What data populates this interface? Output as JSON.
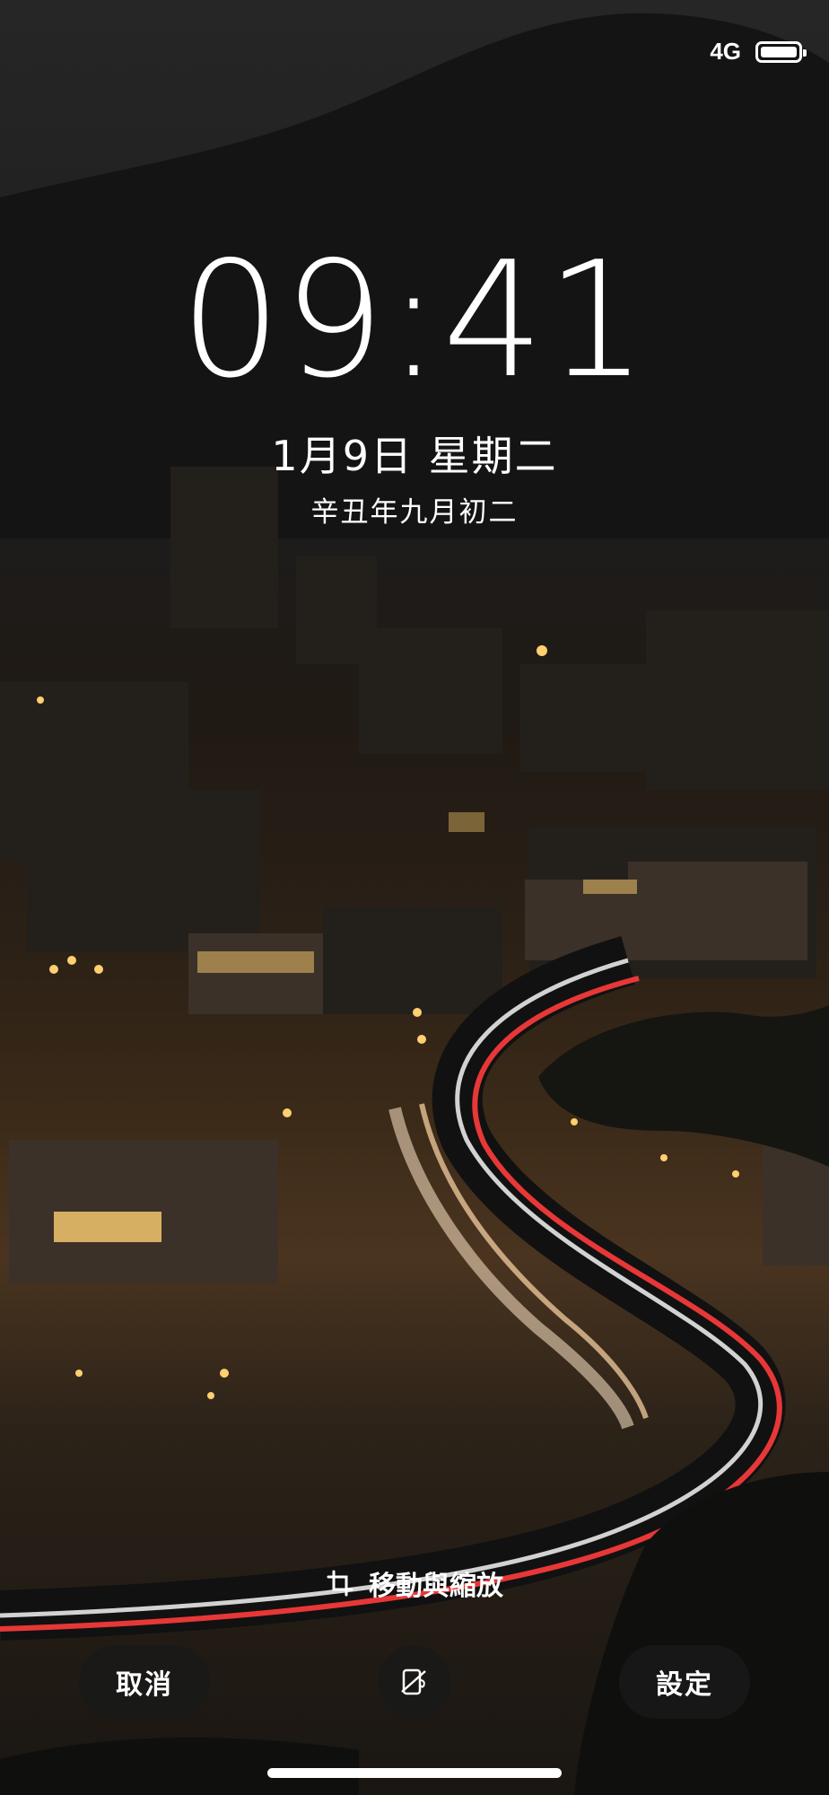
{
  "status": {
    "network": "4G",
    "battery_level": 1.0
  },
  "lockscreen": {
    "time": "09:41",
    "date": "1月9日 星期二",
    "lunar_date": "辛丑年九月初二"
  },
  "wallpaper_editor": {
    "hint_label": "移動與縮放",
    "cancel_label": "取消",
    "set_label": "設定",
    "icons": {
      "hint": "crop-icon",
      "action": "perspective-toggle-icon"
    }
  }
}
